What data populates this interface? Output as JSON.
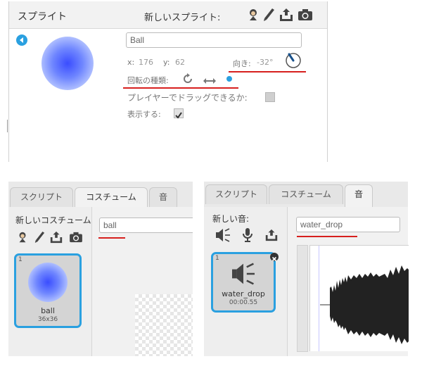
{
  "sprite_panel": {
    "title": "スプライト",
    "new_sprite_label": "新しいスプライト:",
    "sprite_name": "Ball",
    "x_label": "x:",
    "x_value": "176",
    "y_label": "y:",
    "y_value": "62",
    "direction_label": "向き:",
    "direction_value": "-32°",
    "rotation_label": "回転の種類:",
    "draggable_label": "プレイヤーでドラッグできるか:",
    "show_label": "表示する:",
    "show_checked": true,
    "draggable_checked": false
  },
  "costume_editor": {
    "tabs": [
      "スクリプト",
      "コスチューム",
      "音"
    ],
    "active_tab": 1,
    "new_costume_label": "新しいコスチューム:",
    "costume_name": "ball",
    "costume": {
      "number": "1",
      "name": "ball",
      "size": "36x36"
    }
  },
  "sound_editor": {
    "tabs": [
      "スクリプト",
      "コスチューム",
      "音"
    ],
    "active_tab": 2,
    "new_sound_label": "新しい音:",
    "sound_name": "water_drop",
    "sound": {
      "number": "1",
      "name": "water_drop",
      "duration": "00:00.55"
    }
  },
  "colors": {
    "accent_blue": "#2aa0e0",
    "highlight_red": "#d7201e",
    "ball_blue": "#3355ff"
  }
}
